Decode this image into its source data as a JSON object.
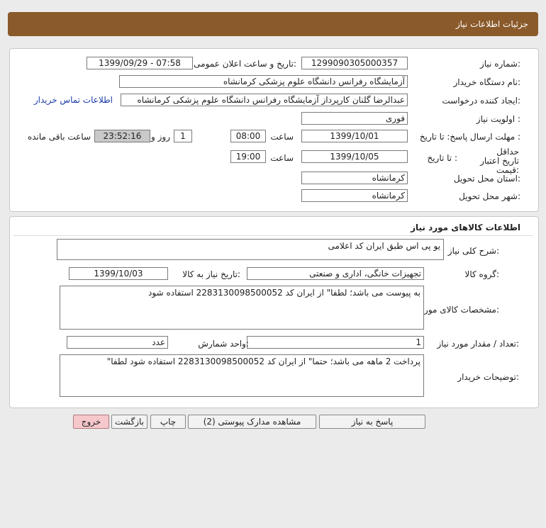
{
  "header": {
    "title": "جزئیات اطلاعات نیاز"
  },
  "need_info": {
    "need_number_label": "شماره نیاز:",
    "need_number": "1299090305000357",
    "announce_label": "تاریخ و ساعت اعلان عمومی:",
    "announce_value": "1399/09/29 - 07:58",
    "buyer_org_label": "نام دستگاه خریدار:",
    "buyer_org": "آزمایشگاه رفرانس دانشگاه علوم پزشکی کرمانشاه",
    "requester_label": "ایجاد کننده درخواست:",
    "requester": "عبدالرضا گلنان کارپرداز آزمایشگاه رفرانس دانشگاه علوم پزشکی کرمانشاه",
    "contact_link": "اطلاعات تماس خریدار",
    "priority_label": "اولویت نیاز :",
    "priority": "فوری",
    "reply_deadline_label": "مهلت ارسال پاسخ: تا تاریخ :",
    "reply_date": "1399/10/01",
    "time_label": "ساعت",
    "reply_time": "08:00",
    "days_value": "1",
    "days_label": "روز و",
    "remaining_time": "23:52:16",
    "remaining_label": "ساعت باقی مانده",
    "price_validity_label": "حداقل تاریخ اعتبار قیمت:",
    "to_date_label": "تا تاریخ :",
    "validity_date": "1399/10/05",
    "validity_time": "19:00",
    "province_label": "استان محل تحویل:",
    "province": "کرمانشاه",
    "city_label": "شهر محل تحویل:",
    "city": "کرمانشاه"
  },
  "goods": {
    "section_title": "اطلاعات کالاهای مورد نیاز",
    "general_desc_label": "شرح کلی نیاز:",
    "general_desc": "یو پی اس طبق ایران کد اعلامی",
    "group_label": "گروه کالا:",
    "group": "تجهیزات خانگی، اداری و صنعتی",
    "need_date_label": "تاریخ نیاز به کالا:",
    "need_date": "1399/10/03",
    "specs_label": "مشخصات کالای مورد نیاز:",
    "specs": "به پیوست می باشد؛ لطفا\" از ایران کد 2283130098500052 استفاده شود",
    "qty_label": "تعداد / مقدار مورد نیاز:",
    "qty": "1",
    "unit_label": "واحد شمارش:",
    "unit": "عدد",
    "buyer_notes_label": "توضیحات خریدار:",
    "buyer_notes": "پرداخت 2 ماهه می باشد؛ حتما\" از ایران کد 2283130098500052 استفاده شود لطفا\""
  },
  "buttons": {
    "reply": "پاسخ به نیاز",
    "attachments": "مشاهده مدارک پیوستی (2)",
    "print": "چاپ",
    "back": "بازگشت",
    "exit": "خروج"
  }
}
